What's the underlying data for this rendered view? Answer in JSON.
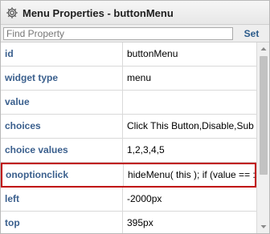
{
  "window": {
    "title": "Menu Properties - buttonMenu",
    "icon": "gear-icon"
  },
  "search": {
    "placeholder": "Find Property",
    "value": "",
    "set_label": "Set"
  },
  "properties": [
    {
      "key": "id",
      "value": "buttonMenu",
      "highlighted": false
    },
    {
      "key": "widget type",
      "value": "menu",
      "highlighted": false
    },
    {
      "key": "value",
      "value": "",
      "highlighted": false
    },
    {
      "key": "choices",
      "value": "Click This Button,Disable,Sub",
      "highlighted": false
    },
    {
      "key": "choice values",
      "value": "1,2,3,4,5",
      "highlighted": false
    },
    {
      "key": "onoptionclick",
      "value": "hideMenu( this ); if (value == :",
      "highlighted": true
    },
    {
      "key": "left",
      "value": "-2000px",
      "highlighted": false
    },
    {
      "key": "top",
      "value": "395px",
      "highlighted": false
    }
  ],
  "colors": {
    "key_text": "#3a5f8d",
    "highlight_border": "#c00000"
  }
}
